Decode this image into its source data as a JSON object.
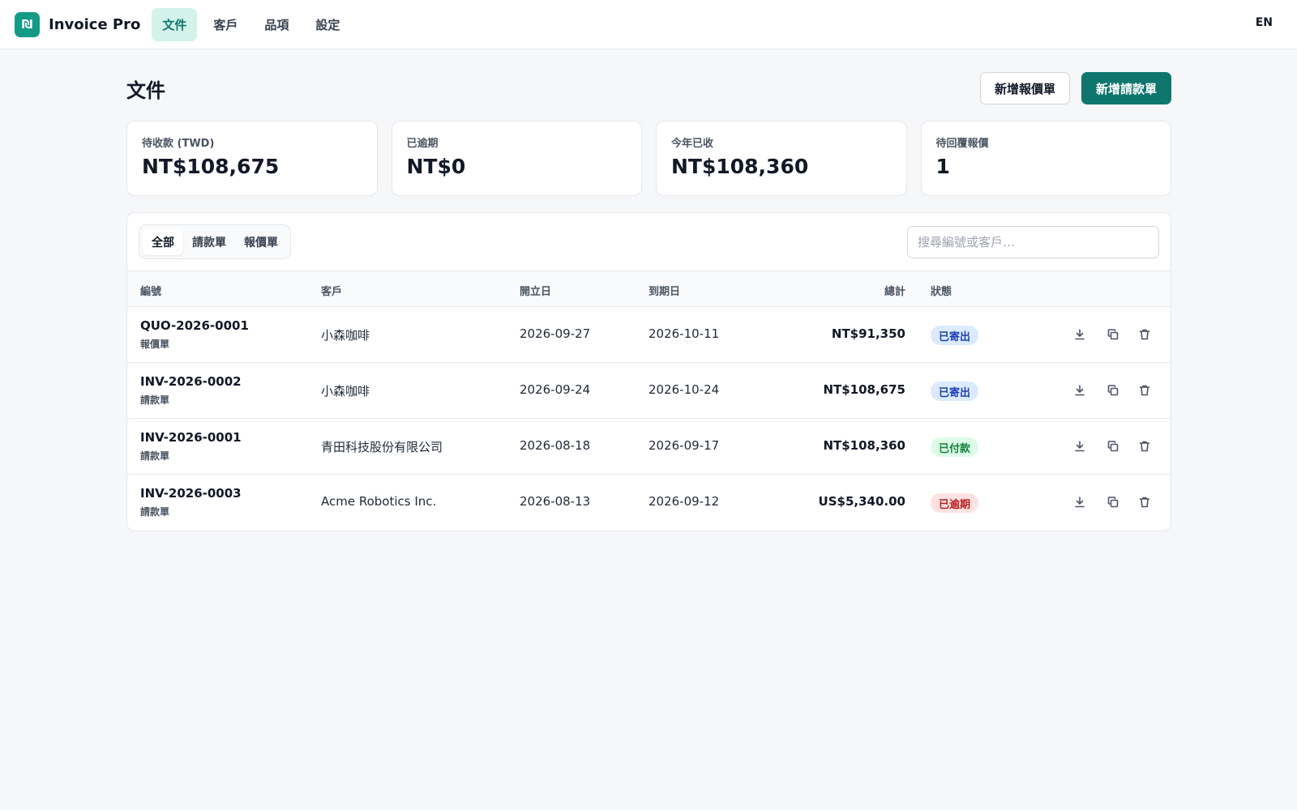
{
  "app": {
    "logo_glyph": "₪",
    "name": "Invoice Pro"
  },
  "nav": [
    {
      "label": "文件",
      "active": true
    },
    {
      "label": "客戶",
      "active": false
    },
    {
      "label": "品項",
      "active": false
    },
    {
      "label": "設定",
      "active": false
    }
  ],
  "lang_toggle": "EN",
  "page": {
    "title": "文件",
    "new_quote_label": "新增報價單",
    "new_invoice_label": "新增請款單"
  },
  "stats": [
    {
      "label": "待收款 (TWD)",
      "value": "NT$108,675"
    },
    {
      "label": "已逾期",
      "value": "NT$0"
    },
    {
      "label": "今年已收",
      "value": "NT$108,360"
    },
    {
      "label": "待回覆報價",
      "value": "1"
    }
  ],
  "filters": {
    "tabs": [
      {
        "label": "全部",
        "active": true
      },
      {
        "label": "請款單",
        "active": false
      },
      {
        "label": "報價單",
        "active": false
      }
    ],
    "search_placeholder": "搜尋編號或客戶…",
    "search_value": ""
  },
  "table": {
    "headers": {
      "number": "編號",
      "client": "客戶",
      "issue_date": "開立日",
      "due_date": "到期日",
      "total": "總計",
      "status": "狀態"
    },
    "rows": [
      {
        "number": "QUO-2026-0001",
        "type": "報價單",
        "client": "小森咖啡",
        "issue_date": "2026-09-27",
        "due_date": "2026-10-11",
        "total": "NT$91,350",
        "status": "已寄出",
        "status_kind": "sent"
      },
      {
        "number": "INV-2026-0002",
        "type": "請款單",
        "client": "小森咖啡",
        "issue_date": "2026-09-24",
        "due_date": "2026-10-24",
        "total": "NT$108,675",
        "status": "已寄出",
        "status_kind": "sent"
      },
      {
        "number": "INV-2026-0001",
        "type": "請款單",
        "client": "青田科技股份有限公司",
        "issue_date": "2026-08-18",
        "due_date": "2026-09-17",
        "total": "NT$108,360",
        "status": "已付款",
        "status_kind": "paid"
      },
      {
        "number": "INV-2026-0003",
        "type": "請款單",
        "client": "Acme Robotics Inc.",
        "issue_date": "2026-08-13",
        "due_date": "2026-09-12",
        "total": "US$5,340.00",
        "status": "已逾期",
        "status_kind": "overdue"
      }
    ],
    "row_actions": [
      "download-icon",
      "copy-icon",
      "trash-icon"
    ]
  },
  "colors": {
    "accent": "#0f766e",
    "logo": "#149b86",
    "nav_active_bg": "#d3f3ea",
    "status_sent": "#1e40af",
    "status_paid": "#15803d",
    "status_overdue": "#b91c1c"
  }
}
